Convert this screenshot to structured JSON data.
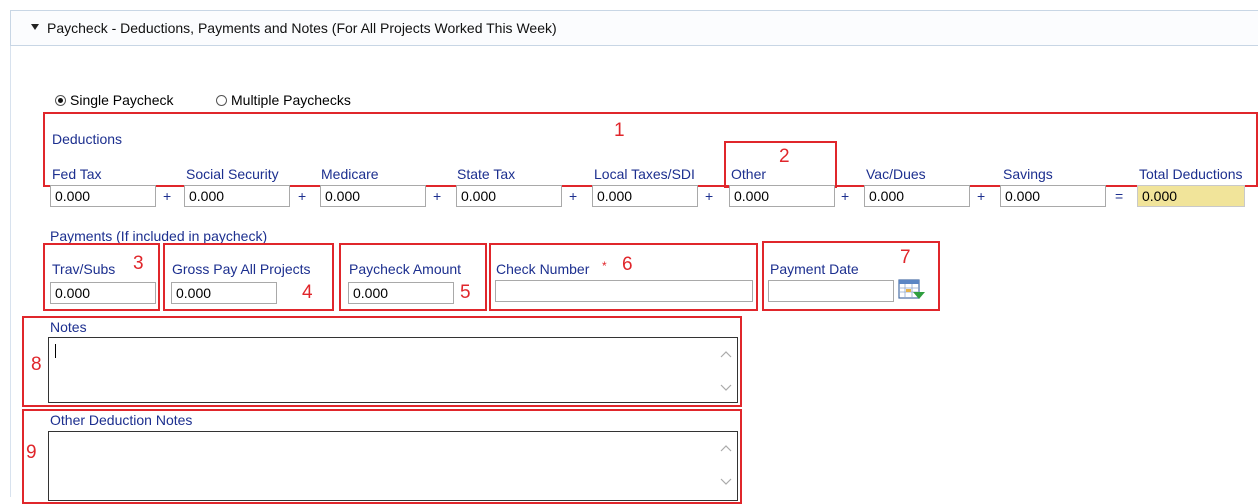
{
  "header": {
    "title": "Paycheck - Deductions, Payments and Notes (For All Projects Worked This Week)"
  },
  "paycheck_mode": {
    "options": [
      {
        "label": "Single Paycheck",
        "selected": true
      },
      {
        "label": "Multiple Paychecks",
        "selected": false
      }
    ]
  },
  "deductions": {
    "section_label": "Deductions",
    "fields": [
      {
        "label": "Fed Tax",
        "value": "0.000",
        "op": "+"
      },
      {
        "label": "Social Security",
        "value": "0.000",
        "op": "+"
      },
      {
        "label": "Medicare",
        "value": "0.000",
        "op": "+"
      },
      {
        "label": "State Tax",
        "value": "0.000",
        "op": "+"
      },
      {
        "label": "Local Taxes/SDI",
        "value": "0.000",
        "op": "+"
      },
      {
        "label": "Other",
        "value": "0.000",
        "op": "+"
      },
      {
        "label": "Vac/Dues",
        "value": "0.000",
        "op": "+"
      },
      {
        "label": "Savings",
        "value": "0.000",
        "op": "="
      },
      {
        "label": "Total Deductions",
        "value": "0.000"
      }
    ]
  },
  "payments": {
    "section_label": "Payments (If included in paycheck)",
    "trav_subs": {
      "label": "Trav/Subs",
      "value": "0.000"
    },
    "gross_pay": {
      "label": "Gross Pay All Projects",
      "value": "0.000"
    },
    "paycheck_amount": {
      "label": "Paycheck Amount",
      "value": "0.000"
    },
    "check_number": {
      "label": "Check Number",
      "required_mark": "*",
      "value": ""
    },
    "payment_date": {
      "label": "Payment Date",
      "value": ""
    }
  },
  "notes": {
    "label": "Notes",
    "value": ""
  },
  "other_deduction_notes": {
    "label": "Other Deduction Notes",
    "value": ""
  },
  "annotations": [
    "1",
    "2",
    "3",
    "4",
    "5",
    "6",
    "7",
    "8",
    "9"
  ],
  "colors": {
    "annotation_red": "#e0262b",
    "label_blue": "#1c2f8f",
    "total_highlight": "#f1e49a"
  }
}
